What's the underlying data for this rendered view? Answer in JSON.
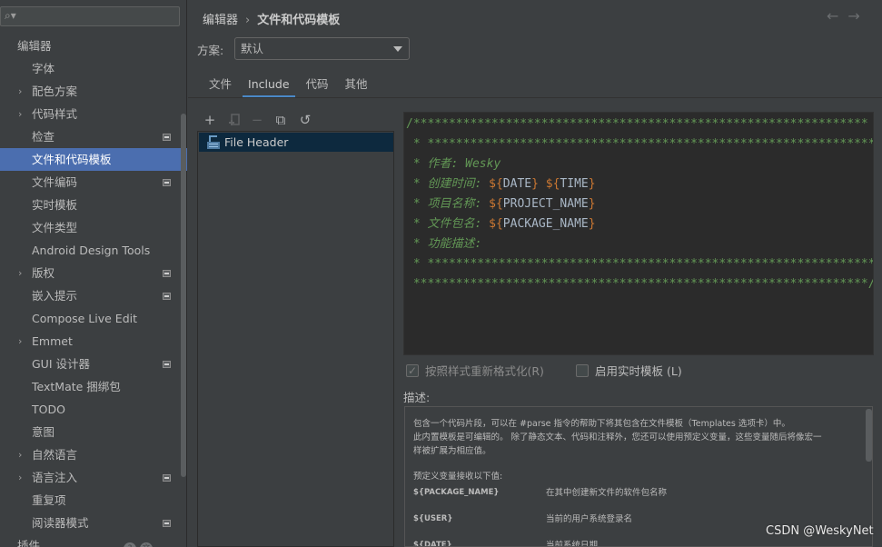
{
  "sidebar": {
    "search_icon": "search-icon",
    "items": [
      {
        "label": "编辑器",
        "level": 0,
        "arrow": false,
        "mod": false,
        "selected": false
      },
      {
        "label": "字体",
        "level": 1,
        "arrow": false,
        "mod": false,
        "selected": false
      },
      {
        "label": "配色方案",
        "level": 1,
        "arrow": true,
        "mod": false,
        "selected": false
      },
      {
        "label": "代码样式",
        "level": 1,
        "arrow": true,
        "mod": false,
        "selected": false
      },
      {
        "label": "检查",
        "level": 1,
        "arrow": false,
        "mod": true,
        "selected": false
      },
      {
        "label": "文件和代码模板",
        "level": 1,
        "arrow": false,
        "mod": false,
        "selected": true
      },
      {
        "label": "文件编码",
        "level": 1,
        "arrow": false,
        "mod": true,
        "selected": false
      },
      {
        "label": "实时模板",
        "level": 1,
        "arrow": false,
        "mod": false,
        "selected": false
      },
      {
        "label": "文件类型",
        "level": 1,
        "arrow": false,
        "mod": false,
        "selected": false
      },
      {
        "label": "Android Design Tools",
        "level": 1,
        "arrow": false,
        "mod": false,
        "selected": false
      },
      {
        "label": "版权",
        "level": 1,
        "arrow": true,
        "mod": true,
        "selected": false
      },
      {
        "label": "嵌入提示",
        "level": 1,
        "arrow": false,
        "mod": true,
        "selected": false
      },
      {
        "label": "Compose Live Edit",
        "level": 1,
        "arrow": false,
        "mod": false,
        "selected": false
      },
      {
        "label": "Emmet",
        "level": 1,
        "arrow": true,
        "mod": false,
        "selected": false
      },
      {
        "label": "GUI 设计器",
        "level": 1,
        "arrow": false,
        "mod": true,
        "selected": false
      },
      {
        "label": "TextMate 捆绑包",
        "level": 1,
        "arrow": false,
        "mod": false,
        "selected": false
      },
      {
        "label": "TODO",
        "level": 1,
        "arrow": false,
        "mod": false,
        "selected": false
      },
      {
        "label": "意图",
        "level": 1,
        "arrow": false,
        "mod": false,
        "selected": false
      },
      {
        "label": "自然语言",
        "level": 1,
        "arrow": true,
        "mod": false,
        "selected": false
      },
      {
        "label": "语言注入",
        "level": 1,
        "arrow": true,
        "mod": true,
        "selected": false
      },
      {
        "label": "重复项",
        "level": 1,
        "arrow": false,
        "mod": false,
        "selected": false
      },
      {
        "label": "阅读器模式",
        "level": 1,
        "arrow": false,
        "mod": true,
        "selected": false
      },
      {
        "label": "插件",
        "level": 0,
        "arrow": false,
        "mod": false,
        "selected": false
      }
    ]
  },
  "header": {
    "breadcrumb_parent": "编辑器",
    "breadcrumb_sep": "›",
    "breadcrumb_current": "文件和代码模板",
    "back_glyph": "←",
    "forward_glyph": "→"
  },
  "scheme": {
    "label": "方案:",
    "value": "默认"
  },
  "tabs": [
    {
      "label": "文件",
      "active": false
    },
    {
      "label": "Include",
      "active": true
    },
    {
      "label": "代码",
      "active": false
    },
    {
      "label": "其他",
      "active": false
    }
  ],
  "toolbar": {
    "add_glyph": "+",
    "remove_glyph": "−",
    "copy_glyph": "⧉",
    "reset_glyph": "↺"
  },
  "templates": {
    "items": [
      "File Header"
    ]
  },
  "editor": {
    "lines": [
      {
        "parts": [
          {
            "t": "/****************************************************************"
          }
        ]
      },
      {
        "parts": [
          {
            "t": " * ***************************************************************"
          }
        ]
      },
      {
        "parts": [
          {
            "t": " * 作者: Wesky",
            "i": true
          }
        ]
      },
      {
        "parts": [
          {
            "t": " * 创建时间: ",
            "i": true
          },
          {
            "v": "${",
            "n": "DATE",
            "e": "}"
          },
          {
            "t": " "
          },
          {
            "v": "${",
            "n": "TIME",
            "e": "}"
          }
        ]
      },
      {
        "parts": [
          {
            "t": " * 项目名称: ",
            "i": true
          },
          {
            "v": "${",
            "n": "PROJECT_NAME",
            "e": "}"
          }
        ]
      },
      {
        "parts": [
          {
            "t": " * 文件包名: ",
            "i": true
          },
          {
            "v": "${",
            "n": "PACKAGE_NAME",
            "e": "}"
          }
        ]
      },
      {
        "parts": [
          {
            "t": " * 功能描述:",
            "i": true
          }
        ]
      },
      {
        "parts": [
          {
            "t": " * ***************************************************************"
          }
        ]
      },
      {
        "parts": [
          {
            "t": " ****************************************************************/"
          }
        ]
      }
    ]
  },
  "options": {
    "reformat_label": "按照样式重新格式化(R)",
    "reformat_checked": true,
    "live_template_label": "启用实时模板 (L)",
    "live_template_checked": false
  },
  "description": {
    "label": "描述:",
    "paragraph1": "包含一个代码片段，可以在 #parse 指令的帮助下将其包含在文件模板（Templates 选项卡）中。",
    "paragraph2": "此内置模板是可编辑的。 除了静态文本、代码和注释外，您还可以使用预定义变量，这些变量随后将像宏一",
    "paragraph3": "样被扩展为相应值。",
    "vars_intro": "预定义变量接收以下值:",
    "vars": [
      {
        "name": "${PACKAGE_NAME}",
        "desc": "在其中创建新文件的软件包名称"
      },
      {
        "name": "${USER}",
        "desc": "当前的用户系统登录名"
      },
      {
        "name": "${DATE}",
        "desc": "当前系统日期"
      }
    ]
  },
  "watermark": "CSDN @WeskyNet",
  "colors": {
    "selection": "#4b6eaf",
    "editor_bg": "#2b2b2b",
    "comment_green": "#629755",
    "var_orange": "#cc7832",
    "tab_underline": "#4a88c7"
  }
}
